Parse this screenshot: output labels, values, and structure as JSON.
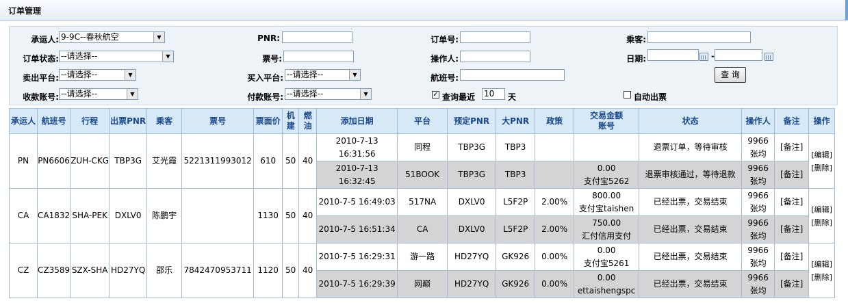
{
  "page_title": "订单管理",
  "form": {
    "carrier_label": "承运人:",
    "carrier_value": "9-9C--春秋航空",
    "pnr_label": "PNR:",
    "order_no_label": "订单号:",
    "passenger_label": "乘客:",
    "order_status_label": "订单状态:",
    "order_status_value": "--请选择--",
    "ticket_no_label": "票号:",
    "operator_label": "操作人:",
    "date_label": "日期:",
    "date_separator": "-",
    "sell_platform_label": "卖出平台:",
    "sell_platform_value": "--请选择--",
    "buy_platform_label": "买入平台:",
    "buy_platform_value": "--请选择--",
    "flight_no_label": "航班号:",
    "query_button": "查 询",
    "receive_account_label": "收款账号:",
    "receive_account_value": "--请选择--",
    "pay_account_label": "付款账号:",
    "pay_account_value": "--请选择--",
    "recent_checkbox_mark": "✓",
    "recent_label": "查询最近",
    "recent_days": "10",
    "days_unit": "天",
    "auto_issue_label": "自动出票"
  },
  "table": {
    "headers": {
      "carrier": "承运人",
      "flight": "航班号",
      "route": "行程",
      "issue_pnr": "出票PNR",
      "passenger": "乘客",
      "ticket_no": "票号",
      "fare": "票面价",
      "airport_tax_1": "机",
      "airport_tax_2": "建",
      "fuel_1": "燃",
      "fuel_2": "油",
      "add_date": "添加日期",
      "platform": "平台",
      "book_pnr": "预定PNR",
      "big_pnr": "大PNR",
      "policy": "政策",
      "amount_1": "交易金额",
      "amount_2": "账号",
      "status": "状态",
      "operator": "操作人",
      "remark": "备注",
      "action": "操作"
    },
    "orders": [
      {
        "carrier": "PN",
        "flight": "PN6606",
        "route": "ZUH-CKG",
        "pnr": "TBP3G",
        "passenger": "艾光霞",
        "ticket": "5221311993012",
        "fare": "610",
        "tax": "50",
        "fuel": "40",
        "edit": "[编辑]",
        "delete": "[删除]",
        "records": [
          {
            "date": "2010-7-13 16:31:56",
            "platform": "同程",
            "book_pnr": "TBP3G",
            "big_pnr": "TBP3",
            "policy": "",
            "amount": "",
            "account": "",
            "status": "退票订单，等待审核",
            "operator_1": "9966",
            "operator_2": "张均",
            "remark": "[备注]"
          },
          {
            "date": "2010-7-13 16:32:45",
            "platform": "51BOOK",
            "book_pnr": "TBP3G",
            "big_pnr": "TBP3",
            "policy": "",
            "amount": "0.00",
            "account": "支付宝5262",
            "status": "退票审核通过，等待退款",
            "operator_1": "9966",
            "operator_2": "张均",
            "remark": "[备注]"
          }
        ]
      },
      {
        "carrier": "CA",
        "flight": "CA1832",
        "route": "SHA-PEK",
        "pnr": "DXLV0",
        "passenger": "陈鹏宇",
        "ticket": "",
        "fare": "1130",
        "tax": "50",
        "fuel": "40",
        "edit": "[编辑]",
        "delete": "[删除]",
        "records": [
          {
            "date": "2010-7-5 16:49:03",
            "platform": "517NA",
            "book_pnr": "DXLV0",
            "big_pnr": "L5F2P",
            "policy": "2.00%",
            "amount": "800.00",
            "account": "支付宝taishen",
            "status": "已经出票，交易结束",
            "operator_1": "9966",
            "operator_2": "张均",
            "remark": "[备注]"
          },
          {
            "date": "2010-7-5 16:51:34",
            "platform": "CA",
            "book_pnr": "DXLV0",
            "big_pnr": "L5F2P",
            "policy": "2.00%",
            "amount": "750.00",
            "account": "汇付信用支付",
            "status": "已经出票，交易结束",
            "operator_1": "9966",
            "operator_2": "张均",
            "remark": "[备注]"
          }
        ]
      },
      {
        "carrier": "CZ",
        "flight": "CZ3589",
        "route": "SZX-SHA",
        "pnr": "HD27YQ",
        "passenger": "邵乐",
        "ticket": "7842470953711",
        "fare": "1120",
        "tax": "50",
        "fuel": "40",
        "edit": "[编辑]",
        "delete": "[删除]",
        "records": [
          {
            "date": "2010-7-5 16:29:31",
            "platform": "游一路",
            "book_pnr": "HD27YQ",
            "big_pnr": "GK926",
            "policy": "0.00%",
            "amount": "0.00",
            "account": "支付宝5261",
            "status": "已经出票，交易结束",
            "operator_1": "9966",
            "operator_2": "张均",
            "remark": "[备注]"
          },
          {
            "date": "2010-7-5 16:29:39",
            "platform": "网巅",
            "book_pnr": "HD27YQ",
            "big_pnr": "GK926",
            "policy": "0.00%",
            "amount": "0.00",
            "account": "ettaishengspc",
            "status": "已经出票，交易结束",
            "operator_1": "9966",
            "operator_2": "张均",
            "remark": "[备注]"
          }
        ]
      }
    ]
  }
}
